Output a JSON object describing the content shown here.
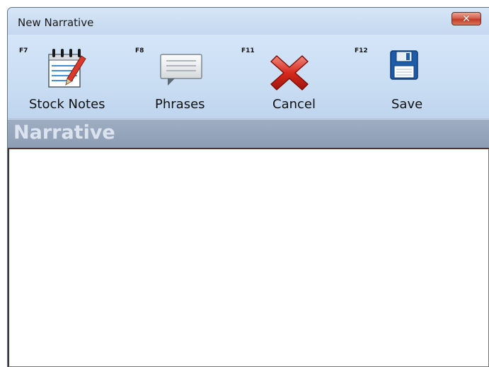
{
  "window": {
    "title": "New Narrative",
    "close_symbol": "✕"
  },
  "toolbar": {
    "items": [
      {
        "hotkey": "F7",
        "label": "Stock Notes",
        "icon": "notepad-pencil-icon"
      },
      {
        "hotkey": "F8",
        "label": "Phrases",
        "icon": "speech-bubble-icon"
      },
      {
        "hotkey": "F11",
        "label": "Cancel",
        "icon": "red-x-icon"
      },
      {
        "hotkey": "F12",
        "label": "Save",
        "icon": "floppy-disk-icon"
      }
    ]
  },
  "narrative": {
    "header": "Narrative",
    "text": ""
  },
  "colors": {
    "toolbar_bg": "#c9ddf3",
    "header_bg": "#8d9db4",
    "close_red": "#c23c26",
    "cancel_red": "#d82a1e",
    "save_blue": "#1d5ca8"
  }
}
